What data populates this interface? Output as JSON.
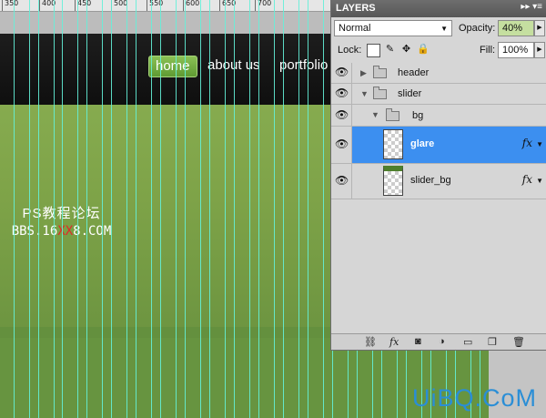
{
  "ruler": {
    "labels": [
      "350",
      "400",
      "450",
      "500",
      "550",
      "600",
      "650",
      "700"
    ]
  },
  "canvas": {
    "nav": {
      "home": "home",
      "about": "about us",
      "portfolio": "portfolio"
    }
  },
  "watermark": {
    "line1": "PS教程论坛",
    "line2_a": "BBS.16",
    "line2_b": "XX",
    "line2_c": "8.COM"
  },
  "layers_panel": {
    "title": "LAYERS",
    "panel_menu": "▸▸ ▾≡",
    "blend_mode": "Normal",
    "opacity_label": "Opacity:",
    "opacity_value": "40%",
    "lock_label": "Lock:",
    "fill_label": "Fill:",
    "fill_value": "100%",
    "layers": [
      {
        "name": "header",
        "type": "group",
        "expanded": false,
        "visible": true
      },
      {
        "name": "slider",
        "type": "group",
        "expanded": true,
        "visible": true
      },
      {
        "name": "bg",
        "type": "group",
        "expanded": true,
        "visible": true
      },
      {
        "name": "glare",
        "type": "layer",
        "selected": true,
        "fx": "fx",
        "visible": true
      },
      {
        "name": "slider_bg",
        "type": "layer",
        "selected": false,
        "fx": "fx",
        "visible": true
      }
    ],
    "icons": [
      "link-icon",
      "fx-icon",
      "mask-icon",
      "adjustment-icon",
      "folder-icon",
      "new-layer-icon",
      "trash-icon"
    ]
  },
  "logo": {
    "text": "UiBQ.CoM"
  },
  "colors": {
    "guide": "#64f0d8",
    "selection": "#3c8ff0",
    "green": "#7ea348",
    "logo": "#2a8ed6"
  }
}
